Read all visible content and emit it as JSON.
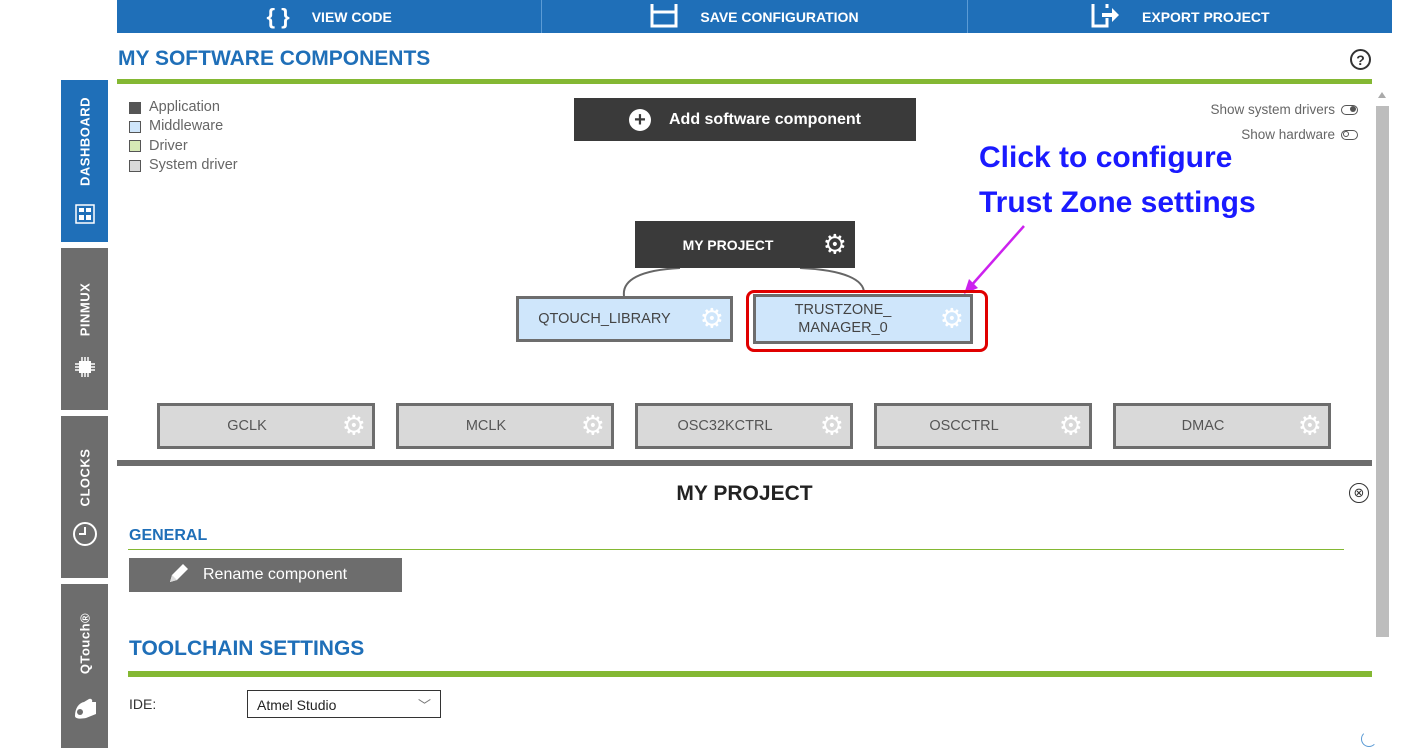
{
  "toolbar": {
    "view_code": {
      "label": "VIEW CODE",
      "icon": "braces-icon"
    },
    "save_configuration": {
      "label": "SAVE CONFIGURATION",
      "icon": "save-icon"
    },
    "export_project": {
      "label": "EXPORT PROJECT",
      "icon": "export-icon"
    }
  },
  "sidebar": {
    "tabs": [
      {
        "label": "DASHBOARD",
        "icon": "dashboard-icon",
        "active": true
      },
      {
        "label": "PINMUX",
        "icon": "chip-icon",
        "active": false
      },
      {
        "label": "CLOCKS",
        "icon": "clock-icon",
        "active": false
      },
      {
        "label": "QTouch®",
        "icon": "touch-hand-icon",
        "active": false
      }
    ]
  },
  "header": {
    "title": "MY SOFTWARE COMPONENTS",
    "help": "?"
  },
  "legend": {
    "items": [
      {
        "label": "Application",
        "color": "#555555"
      },
      {
        "label": "Middleware",
        "color": "#cfe6fb"
      },
      {
        "label": "Driver",
        "color": "#d6e9b5"
      },
      {
        "label": "System driver",
        "color": "#d9d9d9"
      }
    ]
  },
  "add_component": {
    "label": "Add software component"
  },
  "toggles": {
    "show_system_drivers": "Show system drivers",
    "show_hardware": "Show hardware"
  },
  "annotation": {
    "line1": "Click to configure",
    "line2": "Trust Zone settings"
  },
  "diagram": {
    "project": "MY PROJECT",
    "middleware": [
      "QTOUCH_LIBRARY",
      "TRUSTZONE_\nMANAGER_0"
    ],
    "system_drivers": [
      "GCLK",
      "MCLK",
      "OSC32KCTRL",
      "OSCCTRL",
      "DMAC"
    ]
  },
  "panel": {
    "title": "MY PROJECT",
    "close": "⊗",
    "general": {
      "label": "GENERAL",
      "rename_label": "Rename component"
    },
    "toolchain": {
      "label": "TOOLCHAIN SETTINGS",
      "ide_label": "IDE:",
      "ide_value": "Atmel Studio"
    }
  },
  "colors": {
    "accent_blue": "#1f6fb8",
    "accent_green": "#84b833",
    "sidebar_gray": "#6d6d6d",
    "annotation_blue": "#1a1aff",
    "highlight_red": "#e00000",
    "arrow_violet": "#cc22ee"
  }
}
